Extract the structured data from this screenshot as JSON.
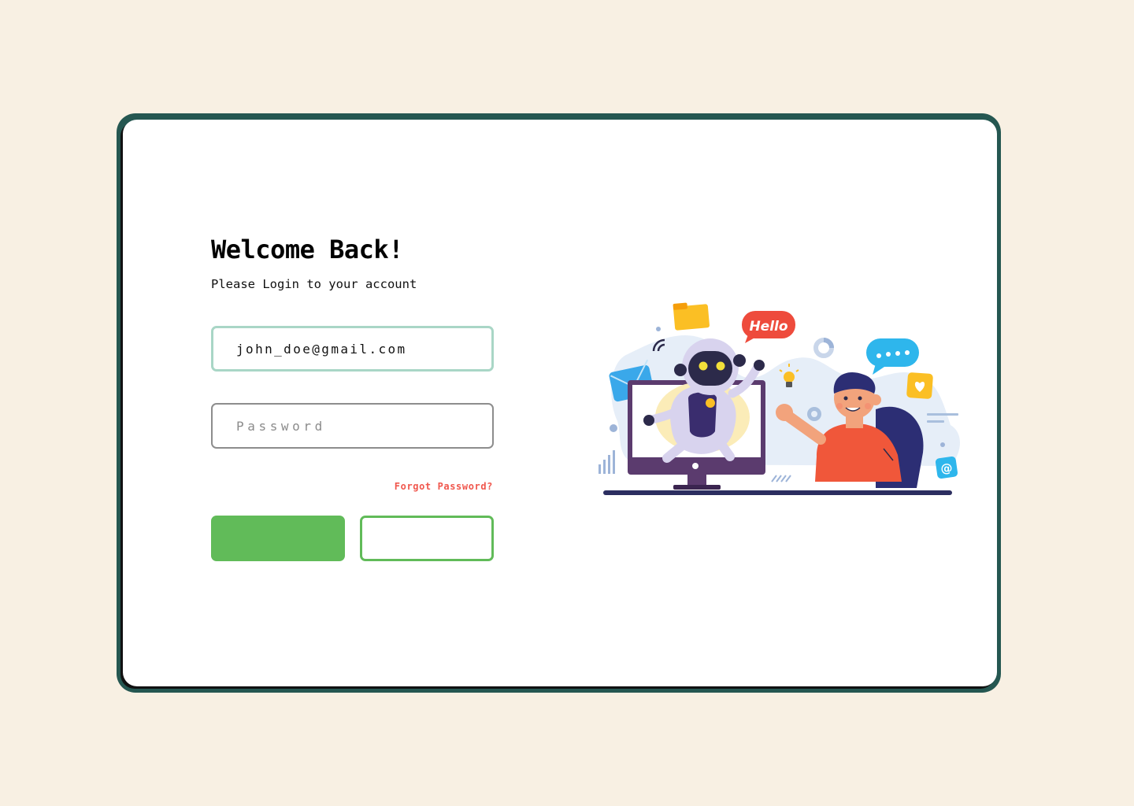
{
  "login": {
    "title": "Welcome Back!",
    "subtitle": "Please Login to your account",
    "email_value": "john_doe@gmail.com",
    "password_placeholder": "Password",
    "forgot_label": "Forgot Password?",
    "login_label": "",
    "signup_label": ""
  },
  "illustration": {
    "speech_text": "Hello"
  },
  "colors": {
    "background": "#f8f0e3",
    "frame": "#255751",
    "accent": "#61bb59",
    "link": "#f0574d"
  }
}
